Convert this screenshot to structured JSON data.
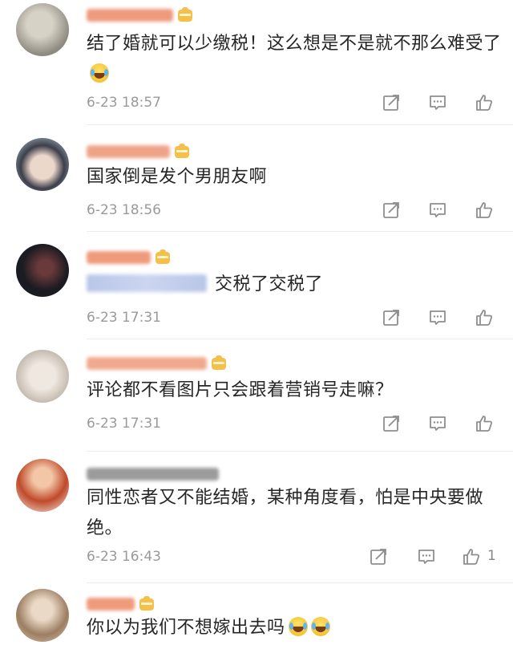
{
  "comments": [
    {
      "text": "结了婚就可以少缴税！这么想是不是就不那么难受了",
      "has_laugh_emoji": true,
      "time": "6-23 18:57",
      "likes": "",
      "avatar_colors": [
        "#c9c4b8",
        "#8f8a80"
      ],
      "name_color": "#ee9a7c",
      "name_width": 108
    },
    {
      "text": "国家倒是发个男朋友啊",
      "time": "6-23 18:56",
      "likes": "",
      "avatar_colors": [
        "#4a4a55",
        "#e8d2c6"
      ],
      "name_color": "#efa48a",
      "name_width": 104
    },
    {
      "mention_blurred": true,
      "text": "交税了交税了",
      "time": "6-23 17:31",
      "likes": "",
      "avatar_colors": [
        "#1b1b22",
        "#6a3a3a"
      ],
      "name_color": "#ee9a7c",
      "name_width": 80
    },
    {
      "text": "评论都不看图片只会跟着营销号走嘛？",
      "time": "6-23 17:31",
      "likes": "",
      "avatar_colors": [
        "#e4ddd5",
        "#b9aea3"
      ],
      "name_color": "#f0a98e",
      "name_width": 150
    },
    {
      "text": "同性恋者又不能结婚，某种角度看，怕是中央要做绝。",
      "time": "6-23 16:43",
      "likes": "1",
      "avatar_colors": [
        "#c04a2a",
        "#f2c6a6"
      ],
      "name_color": "#9b9b9b",
      "name_width": 165
    },
    {
      "text": "你以为我们不想嫁出去吗",
      "has_cry_emojis": true,
      "time": "",
      "likes": "",
      "avatar_colors": [
        "#d8c3ac",
        "#9c7e62"
      ],
      "name_color": "#ee9a7c",
      "name_width": 60
    }
  ],
  "icons": {
    "share": "share-icon",
    "reply": "comment-icon",
    "like": "thumbs-up-icon"
  }
}
